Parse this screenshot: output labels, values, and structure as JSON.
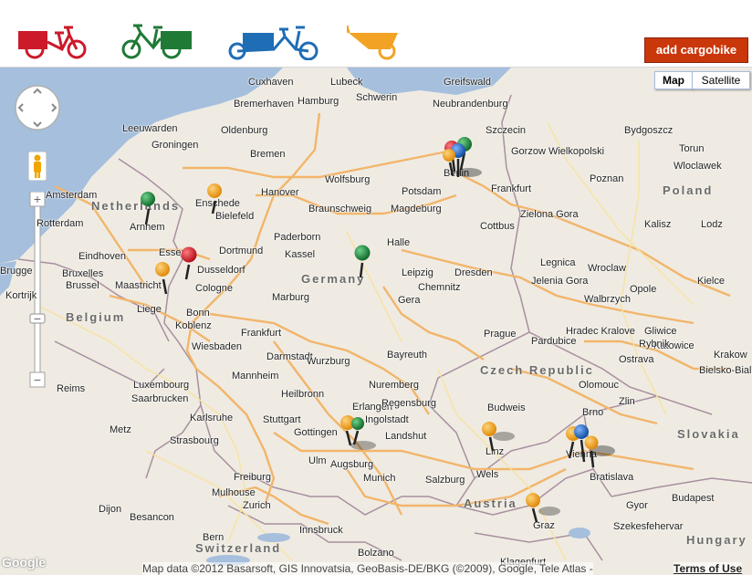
{
  "header": {
    "add_button": "add cargobike",
    "bike_colors": {
      "red": "#cc1a2b",
      "green": "#1f7a36",
      "blue": "#1f6db5",
      "orange": "#f2a324"
    }
  },
  "map_controls": {
    "map_label": "Map",
    "satellite_label": "Satellite",
    "zoom_in": "+",
    "zoom_out": "−"
  },
  "countries": [
    "Netherlands",
    "Belgium",
    "Germany",
    "Poland",
    "Czech Republic",
    "Austria",
    "Switzerland",
    "Luxembourg",
    "Slovakia",
    "Hungary"
  ],
  "cities": [
    "Lubeck",
    "Hamburg",
    "Schwerin",
    "Greifswald",
    "Neubrandenburg",
    "Szczecin",
    "Bydgoszcz",
    "Torun",
    "Gorzow Wielkopolski",
    "Wloclawek",
    "Cuxhaven",
    "Bremerhaven",
    "Oldenburg",
    "Bremen",
    "Groningen",
    "Leeuwarden",
    "Amsterdam",
    "Rotterdam",
    "Arnhem",
    "Eindhoven",
    "Enschede",
    "Hanover",
    "Wolfsburg",
    "Braunschweig",
    "Bielefeld",
    "Magdeburg",
    "Potsdam",
    "Berlin",
    "Frankfurt",
    "Poznan",
    "Zielona Gora",
    "Cottbus",
    "Kalisz",
    "Lodz",
    "Dortmund",
    "Essen",
    "Dusseldorf",
    "Paderborn",
    "Kassel",
    "Halle",
    "Leipzig",
    "Dresden",
    "Legnica",
    "Wroclaw",
    "Opole",
    "Bruxelles",
    "Brussel",
    "Brugge",
    "Kortrijk",
    "Maastricht",
    "Liege",
    "Cologne",
    "Bonn",
    "Koblenz",
    "Marburg",
    "Gera",
    "Chemnitz",
    "Jelenia Gora",
    "Walbrzych",
    "Kielce",
    "Gliwice",
    "Katowice",
    "Krakow",
    "Wiesbaden",
    "Darmstadt",
    "Frankfurt",
    "Bayreuth",
    "Hradec Kralove",
    "Pardubice",
    "Prague",
    "Rybnik",
    "Ostrava",
    "Bielsko-Biala",
    "Luxembourg",
    "Saarbrucken",
    "Mannheim",
    "Wurzburg",
    "Nuremberg",
    "Olomouc",
    "Zlin",
    "Reims",
    "Metz",
    "Karlsruhe",
    "Heilbronn",
    "Erlangen",
    "Regensburg",
    "Budweis",
    "Brno",
    "Stuttgart",
    "Ingolstadt",
    "Gottingen",
    "Augsburg",
    "Linz",
    "Vienna",
    "Bratislava",
    "Strasbourg",
    "Ulm",
    "Landshut",
    "Munich",
    "Freiburg",
    "Salzburg",
    "Wels",
    "Dijon",
    "Zurich",
    "Mulhouse",
    "Bern",
    "Graz",
    "Gyor",
    "Budapest",
    "Szekesfehervar",
    "Besancon",
    "Innsbruck",
    "Bolzano",
    "Klagenfurt"
  ],
  "footer": {
    "attribution": "Map data ©2012 Basarsoft, GIS Innovatsia, GeoBasis-DE/BKG (©2009), Google, Tele Atlas -",
    "terms": "Terms of Use",
    "logo": "Google"
  },
  "markers": [
    {
      "color": "green",
      "city": "Arnhem"
    },
    {
      "color": "orange",
      "city": "Enschede"
    },
    {
      "color": "red",
      "city": "Essen"
    },
    {
      "color": "orange",
      "city": "Maastricht"
    },
    {
      "color": "green",
      "city": "Kassel"
    },
    {
      "color": "red",
      "city": "Berlin"
    },
    {
      "color": "green",
      "city": "Berlin"
    },
    {
      "color": "blue",
      "city": "Berlin"
    },
    {
      "color": "orange",
      "city": "Berlin"
    },
    {
      "color": "orange",
      "city": "Augsburg"
    },
    {
      "color": "green",
      "city": "Ingolstadt"
    },
    {
      "color": "orange",
      "city": "Linz"
    },
    {
      "color": "orange",
      "city": "Vienna"
    },
    {
      "color": "blue",
      "city": "Vienna"
    },
    {
      "color": "orange",
      "city": "Bratislava"
    },
    {
      "color": "orange",
      "city": "Graz"
    }
  ]
}
